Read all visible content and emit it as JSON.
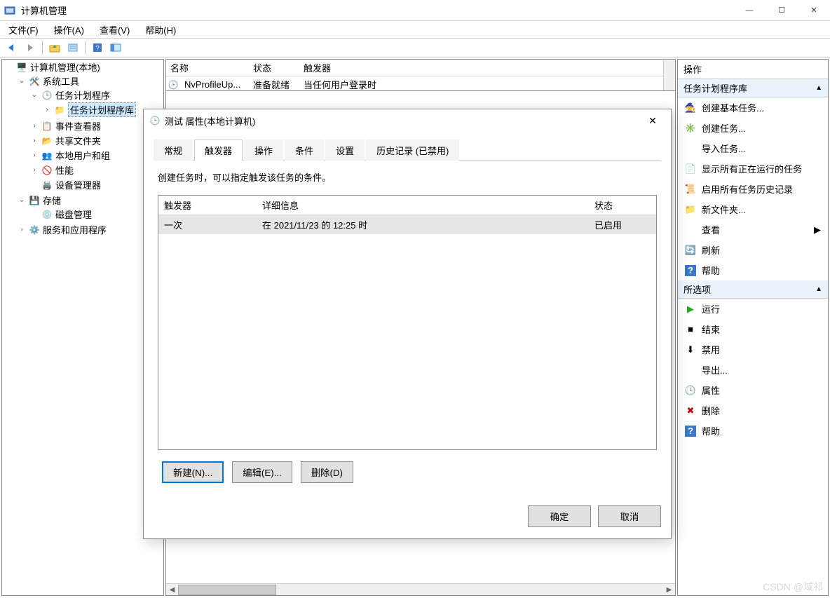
{
  "window": {
    "title": "计算机管理",
    "min": "—",
    "max": "☐",
    "close": "✕"
  },
  "menu": {
    "file": "文件(F)",
    "action": "操作(A)",
    "view": "查看(V)",
    "help": "帮助(H)"
  },
  "tree": {
    "root": "计算机管理(本地)",
    "system_tools": "系统工具",
    "task_scheduler": "任务计划程序",
    "task_lib": "任务计划程序库",
    "event_viewer": "事件查看器",
    "shared_folders": "共享文件夹",
    "local_users": "本地用户和组",
    "performance": "性能",
    "device_manager": "设备管理器",
    "storage": "存储",
    "disk_mgmt": "磁盘管理",
    "services": "服务和应用程序"
  },
  "center": {
    "cols": {
      "name": "名称",
      "status": "状态",
      "trigger": "触发器"
    },
    "row": {
      "name": "NvProfileUp...",
      "status": "准备就绪",
      "trigger": "当任何用户登录时"
    }
  },
  "actions": {
    "header": "操作",
    "group1": "任务计划程序库",
    "items1": [
      "创建基本任务...",
      "创建任务...",
      "导入任务...",
      "显示所有正在运行的任务",
      "启用所有任务历史记录",
      "新文件夹...",
      "查看",
      "刷新",
      "帮助"
    ],
    "group2": "所选项",
    "items2": [
      "运行",
      "结束",
      "禁用",
      "导出...",
      "属性",
      "删除",
      "帮助"
    ]
  },
  "dialog": {
    "title": "测试 属性(本地计算机)",
    "tabs": {
      "general": "常规",
      "triggers": "触发器",
      "actions": "操作",
      "conditions": "条件",
      "settings": "设置",
      "history": "历史记录 (已禁用)"
    },
    "hint": "创建任务时，可以指定触发该任务的条件。",
    "trig_cols": {
      "trigger": "触发器",
      "detail": "详细信息",
      "status": "状态"
    },
    "trig_row": {
      "trigger": "一次",
      "detail": "在 2021/11/23 的 12:25 时",
      "status": "已启用"
    },
    "btn_new": "新建(N)...",
    "btn_edit": "编辑(E)...",
    "btn_delete": "删除(D)",
    "ok": "确定",
    "cancel": "取消"
  },
  "watermark": "CSDN @域祁"
}
